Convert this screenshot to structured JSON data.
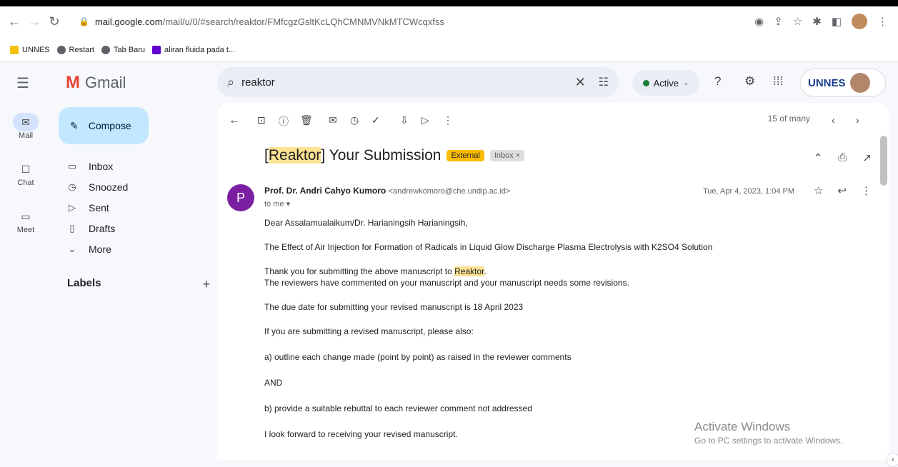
{
  "browser": {
    "url_host": "mail.google.com",
    "url_path": "/mail/u/0/#search/reaktor/FMfcgzGsltKcLQhCMNMVNkMTCWcqxfss",
    "bookmarks": [
      {
        "label": "UNNES",
        "icon": "folder-icon"
      },
      {
        "label": "Restart",
        "icon": "globe-icon"
      },
      {
        "label": "Tab Baru",
        "icon": "globe-icon"
      },
      {
        "label": "aliran fluida pada t...",
        "icon": "yahoo-icon"
      }
    ]
  },
  "gmail": {
    "brand": "Gmail",
    "search_value": "reaktor",
    "status": "Active",
    "account_logo": "UNNES"
  },
  "rail": [
    {
      "label": "Mail",
      "icon": "mail-icon"
    },
    {
      "label": "Chat",
      "icon": "chat-icon"
    },
    {
      "label": "Meet",
      "icon": "meet-icon"
    }
  ],
  "sidebar": {
    "compose": "Compose",
    "folders": [
      {
        "label": "Inbox",
        "icon": "inbox-icon"
      },
      {
        "label": "Snoozed",
        "icon": "snoozed-icon"
      },
      {
        "label": "Sent",
        "icon": "sent-icon"
      },
      {
        "label": "Drafts",
        "icon": "drafts-icon"
      },
      {
        "label": "More",
        "icon": "chevron-down-icon"
      }
    ],
    "labels_title": "Labels"
  },
  "message": {
    "pager": "15 of many",
    "subject_highlight": "Reaktor",
    "subject_pre": "[",
    "subject_post": "] Your Submission",
    "badge_external": "External",
    "badge_inbox": "Inbox ×",
    "sender_initial": "P",
    "sender_name": "Prof. Dr. Andri Cahyo Kumoro",
    "sender_email": "<andrewkomoro@che.undip.ac.id>",
    "to": "to me",
    "date": "Tue, Apr 4, 2023, 1:04 PM",
    "body": {
      "greeting": "Dear Assalamualaikum/Dr. Harianingsih Harianingsih,",
      "title": "The Effect of Air Injection for Formation of Radicals in Liquid Glow Discharge Plasma Electrolysis with K2SO4 Solution",
      "thanks_pre": "Thank you for submitting the above manuscript to ",
      "thanks_hl": "Reaktor",
      "thanks_post": ".",
      "reviewers": "The reviewers have commented on your manuscript and your manuscript needs some revisions.",
      "due": "The due date for submitting your revised manuscript is 18 April 2023",
      "please": "If you are submitting a revised manuscript, please also:",
      "a": "a) outline each change made (point by point) as raised in the reviewer comments",
      "and": "AND",
      "b": "b) provide a suitable rebuttal to each reviewer comment not addressed",
      "forward": "I look forward to receiving your revised manuscript."
    }
  },
  "watermark": {
    "line1": "Activate Windows",
    "line2": "Go to PC settings to activate Windows."
  }
}
